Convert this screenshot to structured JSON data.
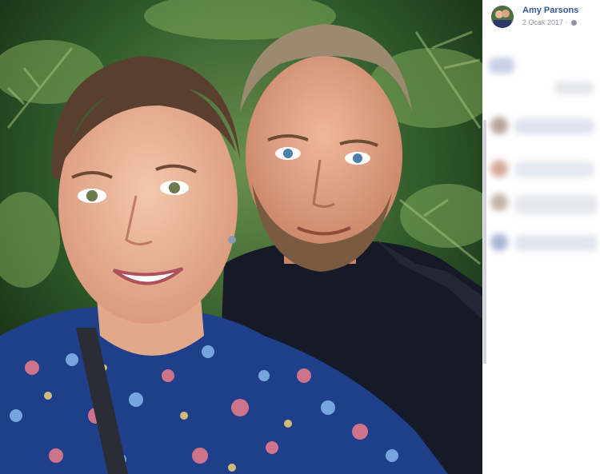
{
  "post": {
    "author": "Amy Parsons",
    "date": "2 Ocak 2017",
    "separator": "·",
    "privacy_icon": "globe-icon"
  },
  "colors": {
    "author_link": "#365899",
    "meta_text": "#90949c",
    "panel_bg": "#ffffff"
  }
}
